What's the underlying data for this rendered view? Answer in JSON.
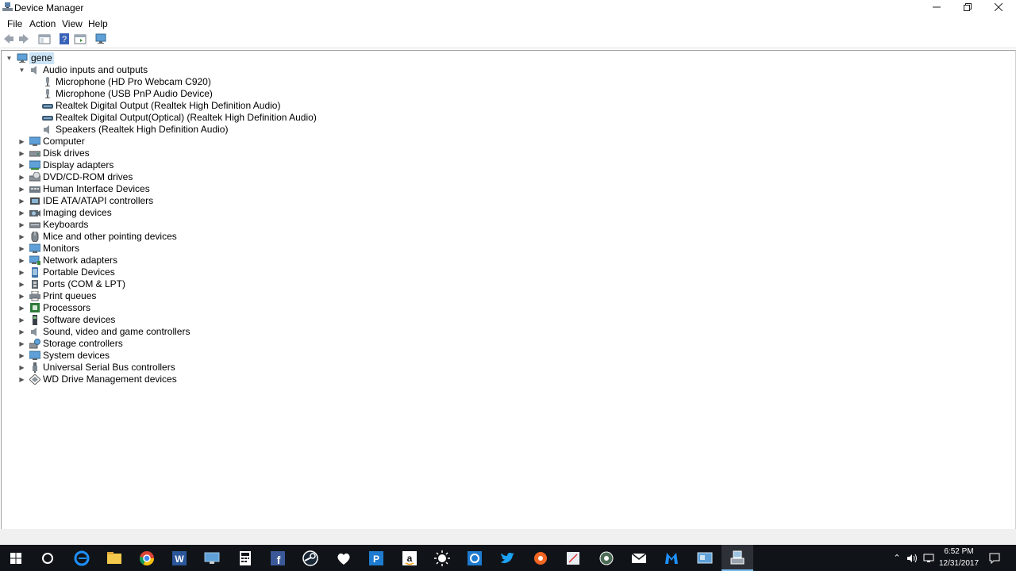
{
  "window": {
    "title": "Device Manager"
  },
  "menu": [
    "File",
    "Action",
    "View",
    "Help"
  ],
  "tree": {
    "root": "gene",
    "expanded_category": "Audio inputs and outputs",
    "audio_children": [
      "Microphone (HD Pro Webcam C920)",
      "Microphone (USB PnP Audio Device)",
      "Realtek Digital Output (Realtek High Definition Audio)",
      "Realtek Digital Output(Optical) (Realtek High Definition Audio)",
      "Speakers (Realtek High Definition Audio)"
    ],
    "categories": [
      "Computer",
      "Disk drives",
      "Display adapters",
      "DVD/CD-ROM drives",
      "Human Interface Devices",
      "IDE ATA/ATAPI controllers",
      "Imaging devices",
      "Keyboards",
      "Mice and other pointing devices",
      "Monitors",
      "Network adapters",
      "Portable Devices",
      "Ports (COM & LPT)",
      "Print queues",
      "Processors",
      "Software devices",
      "Sound, video and game controllers",
      "Storage controllers",
      "System devices",
      "Universal Serial Bus controllers",
      "WD Drive Management devices"
    ]
  },
  "taskbar": {
    "time": "6:52 PM",
    "date": "12/31/2017"
  },
  "colors": {
    "selection": "#cce4f7",
    "taskbar_bg": "#101419",
    "accent": "#0078d7"
  }
}
